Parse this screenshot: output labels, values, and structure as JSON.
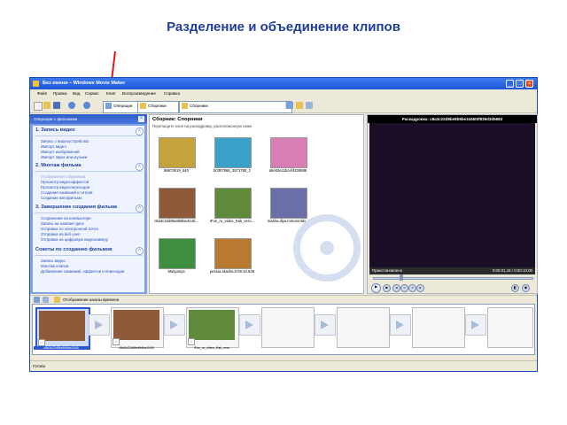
{
  "slide": {
    "title": "Разделение и объединение клипов"
  },
  "window": {
    "title": "Без имени – Windows Movie Maker",
    "min": "_",
    "max": "□",
    "close": "×",
    "menu": [
      "Файл",
      "Правка",
      "Вид",
      "Сервис",
      "Клип",
      "Воспроизведение",
      "Справка"
    ]
  },
  "toolbar": {
    "operations_label": "Операции",
    "collections_label": "Сборники",
    "collection_select": "Сборники"
  },
  "tasks": {
    "header": "Операции с фильмами",
    "close": "×",
    "sections": [
      {
        "title": "1. Запись видео",
        "toggle": "˄",
        "links": [
          "Запись с видеоустройства",
          "Импорт видео",
          "Импорт изображений",
          "Импорт звука или музыки"
        ]
      },
      {
        "title": "2. Монтаж фильма",
        "toggle": "˄",
        "links": [
          "Отображение сборников",
          "Просмотр видеоэффектов",
          "Просмотр видеопереходов",
          "Создание названий и титров",
          "Создание автофильма"
        ]
      },
      {
        "title": "3. Завершение создания фильма",
        "toggle": "˄",
        "links": [
          "Сохранение на компьютере",
          "Запись на компакт-диск",
          "Отправка по электронной почте",
          "Отправка на веб-узел",
          "Отправка на цифровую видеокамеру"
        ]
      },
      {
        "title": "Советы по созданию фильмов",
        "toggle": "˄",
        "links": [
          "Запись видео",
          "Монтаж клипов",
          "Добавление названий, эффектов и переходов"
        ]
      }
    ]
  },
  "collection": {
    "title": "Сборник: Спорники",
    "subtitle": "Перетащите клип на раскадровку, расположенную ниже.",
    "items": [
      {
        "caption": "86673519_640",
        "color": "#c6a23c"
      },
      {
        "caption": "b0307866_3571780_2",
        "color": "#3aa2c8"
      },
      {
        "caption": "a5e63e11bcef420d886",
        "color": "#d77fb5"
      },
      {
        "caption": "c8a3c22d8be8b6be3445...",
        "color": "#8e5a3a"
      },
      {
        "caption": "iFun_ru_video_Kak_vero...",
        "color": "#5f8a3a"
      },
      {
        "caption": "masha.dlya.mmorontiki...",
        "color": "#6a6fa8"
      },
      {
        "caption": "Masyanya",
        "color": "#3d8e3f"
      },
      {
        "caption": "pesnia.skazka.0:09-10.628",
        "color": "#b87a2e"
      }
    ]
  },
  "preview": {
    "title": "Раскадровка: c8a3c22d8be8b6be3445t0f839d3d5683",
    "status": "Приостановлено",
    "time": "0:00:01,16 / 0:00:10,00"
  },
  "storyboard": {
    "toggle_label": "Отображение шкалы времени",
    "clips": [
      {
        "caption": "c8a3c22d8be8b6be3445",
        "color": "#8e5a3a"
      },
      {
        "caption": "c8a3c22d8be8b6be3445",
        "color": "#8e5a3a"
      },
      {
        "caption": "iFun_ru_video_Kak_vero",
        "color": "#5f8a3a"
      }
    ],
    "star": "☆"
  },
  "status": {
    "text": "Готово"
  }
}
